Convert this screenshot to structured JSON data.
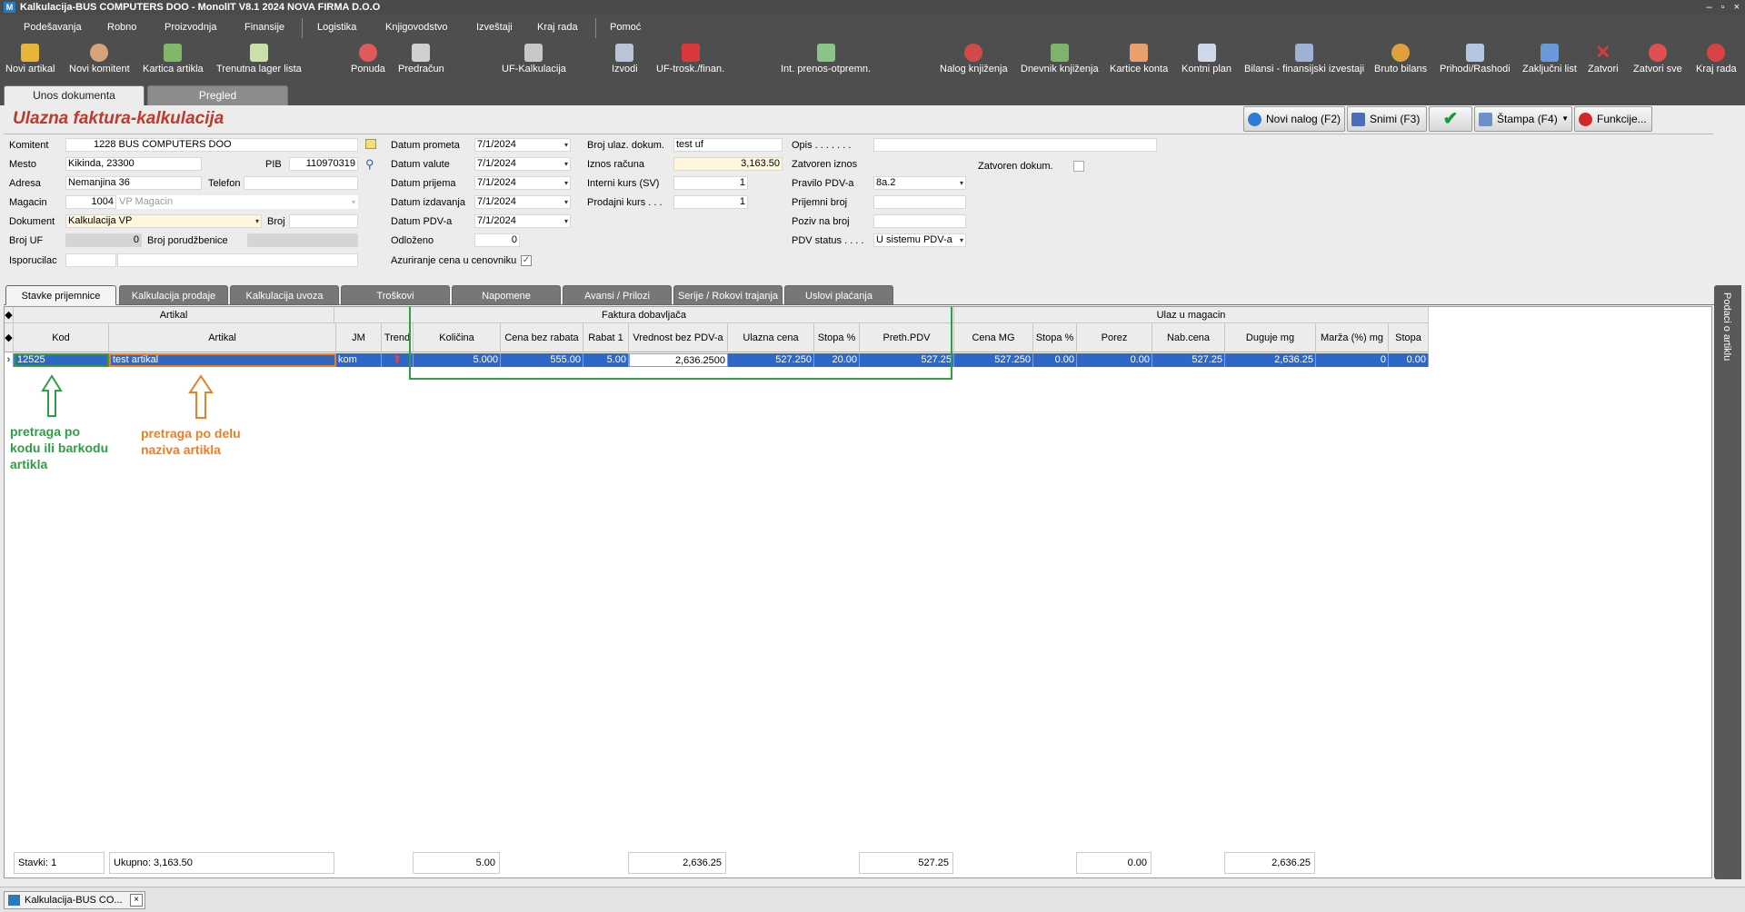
{
  "window": {
    "title": "Kalkulacija-BUS COMPUTERS DOO - MonolIT V8.1 2024 NOVA FIRMA D.O.O"
  },
  "menu": [
    "Podešavanja",
    "Robno",
    "Proizvodnja",
    "Finansije",
    "Logistika",
    "Knjigovodstvo",
    "Izveštaji",
    "Kraj rada",
    "Pomoć"
  ],
  "toolbar": [
    "Novi artikal",
    "Novi komitent",
    "Kartica artikla",
    "Trenutna lager lista",
    "Ponuda",
    "Predračun",
    "UF-Kalkulacija",
    "Izvodi",
    "UF-trosk./finan.",
    "Int. prenos-otpremn.",
    "Nalog knjiženja",
    "Dnevnik knjiženja",
    "Kartice konta",
    "Kontni plan",
    "Bilansi - finansijski izvestaji",
    "Bruto bilans",
    "Prihodi/Rashodi",
    "Zaključni list",
    "Zatvori",
    "Zatvori sve",
    "Kraj rada"
  ],
  "doc_tabs": [
    "Unos dokumenta",
    "Pregled"
  ],
  "page_title": "Ulazna faktura-kalkulacija",
  "actions": {
    "new": "Novi nalog (F2)",
    "save": "Snimi (F3)",
    "print": "Štampa (F4)",
    "functions": "Funkcije..."
  },
  "form": {
    "komitent_label": "Komitent",
    "komitent": "1228 BUS COMPUTERS DOO",
    "mesto_label": "Mesto",
    "mesto": "Kikinda, 23300",
    "pib_label": "PIB",
    "pib": "110970319",
    "adresa_label": "Adresa",
    "adresa": "Nemanjina 36",
    "telefon_label": "Telefon",
    "magacin_label": "Magacin",
    "magacin_code": "1004",
    "magacin_name": "VP Magacin",
    "dokument_label": "Dokument",
    "dokument": "Kalkulacija VP",
    "broj_label": "Broj",
    "broj_uf_label": "Broj UF",
    "broj_uf": "0",
    "broj_porudzbenice_label": "Broj porudžbenice",
    "isporucilac_label": "Isporucilac",
    "datum_prometa_label": "Datum prometa",
    "datum_prometa": "7/1/2024",
    "datum_valute_label": "Datum valute",
    "datum_valute": "7/1/2024",
    "datum_prijema_label": "Datum prijema",
    "datum_prijema": "7/1/2024",
    "datum_izdavanja_label": "Datum izdavanja",
    "datum_izdavanja": "7/1/2024",
    "datum_pdv_label": "Datum PDV-a",
    "datum_pdv": "7/1/2024",
    "odlozeno_label": "Odloženo",
    "odlozeno": "0",
    "azuriranje_label": "Azuriranje cena u cenovniku",
    "broj_ulaz_label": "Broj ulaz. dokum.",
    "broj_ulaz": "test uf",
    "iznos_label": "Iznos računa",
    "iznos": "3,163.50",
    "interni_kurs_label": "Interni kurs (SV)",
    "interni_kurs": "1",
    "prodajni_kurs_label": "Prodajni kurs . . .",
    "prodajni_kurs": "1",
    "opis_label": "Opis . . . . . . .",
    "zatvoren_iznos_label": "Zatvoren iznos",
    "zatvoren_dokum_label": "Zatvoren dokum.",
    "pravilo_label": "Pravilo PDV-a",
    "pravilo": "8a.2",
    "prijemni_label": "Prijemni broj",
    "poziv_label": "Poziv na broj",
    "pdv_status_label": "PDV status . . . .",
    "pdv_status": "U sistemu PDV-a"
  },
  "sub_tabs": [
    "Stavke prijemnice",
    "Kalkulacija prodaje",
    "Kalkulacija uvoza",
    "Troškovi",
    "Napomene",
    "Avansi / Prilozi",
    "Serije / Rokovi trajanja",
    "Uslovi plaćanja"
  ],
  "side_panel": "Podaci o artiklu",
  "grid": {
    "groups": [
      "Artikal",
      "Faktura dobavljača",
      "Ulaz u magacin"
    ],
    "columns": [
      "Kod",
      "Artikal",
      "JM",
      "Trend",
      "Količina",
      "Cena bez rabata",
      "Rabat 1",
      "Vrednost bez PDV-a",
      "Ulazna cena",
      "Stopa %",
      "Preth.PDV",
      "Cena MG",
      "Stopa %",
      "Porez",
      "Nab.cena",
      "Duguje mg",
      "Marža (%) mg",
      "Stopa"
    ],
    "row": [
      "12525",
      "test artikal",
      "kom",
      "",
      "5.000",
      "555.00",
      "5.00",
      "2,636.2500",
      "527.250",
      "20.00",
      "527.25",
      "527.250",
      "0.00",
      "0.00",
      "527.25",
      "2,636.25",
      "0",
      "0.00"
    ],
    "footer": {
      "stavki": "Stavki: 1",
      "ukupno": "Ukupno: 3,163.50",
      "kolicina": "5.00",
      "vrednost": "2,636.25",
      "pdv": "527.25",
      "porez": "0.00",
      "duguje": "2,636.25"
    }
  },
  "annotations": {
    "green": "pretraga po\nkodu ili barkodu\nartikla",
    "orange": "pretraga po delu\nnaziva artikla",
    "green_color": "#2ea043",
    "orange_color": "#ef7d22"
  },
  "taskbar": {
    "item": "Kalkulacija-BUS CO...",
    "close": "×"
  }
}
